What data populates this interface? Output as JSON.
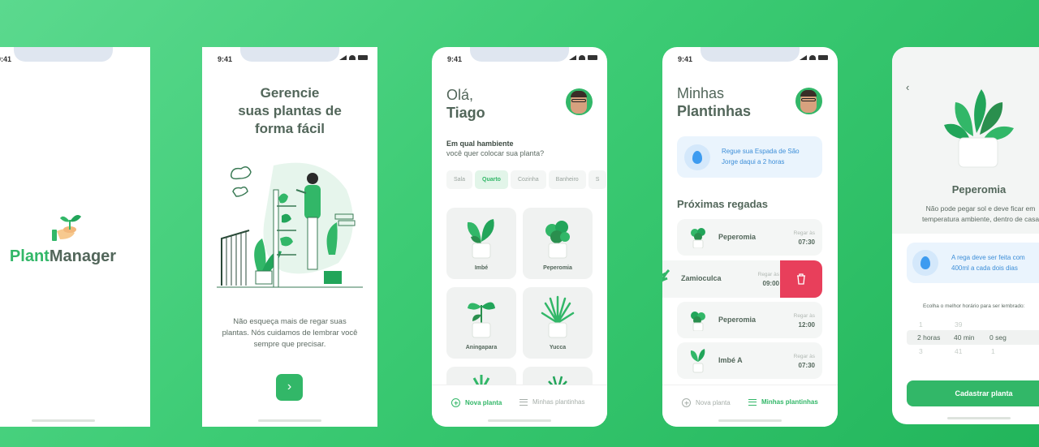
{
  "theme": {
    "accent": "#32b768",
    "heading": "#52665a",
    "danger": "#e83f5b",
    "info": "#3d9bf0"
  },
  "status_time": "9:41",
  "splash": {
    "logo_part1": "Plant",
    "logo_part2": "Manager"
  },
  "onboarding": {
    "title_lines": [
      "Gerencie",
      "suas plantas de",
      "forma fácil"
    ],
    "text_lines": [
      "Não esqueça mais de regar suas",
      "plantas. Nós cuidamos de lembrar você",
      "sempre que precisar."
    ],
    "next_icon": "chevron-right-icon",
    "next_glyph": "›"
  },
  "home": {
    "greeting": "Olá,",
    "user_name": "Tiago",
    "question_bold": "Em qual hambiente",
    "question_rest": "você quer colocar sua planta?",
    "environments": [
      {
        "label": "Sala",
        "active": false
      },
      {
        "label": "Quarto",
        "active": true
      },
      {
        "label": "Cozinha",
        "active": false
      },
      {
        "label": "Banheiro",
        "active": false
      },
      {
        "label": "S",
        "active": false
      }
    ],
    "plants": [
      "Imbé",
      "Peperomia",
      "Aningapara",
      "Yucca"
    ],
    "tabs": {
      "new_plant": "Nova planta",
      "my_plants": "Minhas plantinhas"
    }
  },
  "my_plants": {
    "title_light": "Minhas",
    "title_bold": "Plantinhas",
    "tip_lines": [
      "Regue sua Espada de São",
      "Jorge daqui a 2 horas"
    ],
    "next_title": "Próximas regadas",
    "water_label": "Regar às",
    "rows": [
      {
        "name": "Peperomia",
        "time": "07:30"
      },
      {
        "name": "Zamioculca",
        "time": "09:00"
      },
      {
        "name": "Peperomia",
        "time": "12:00"
      },
      {
        "name": "Imbé A",
        "time": "07:30"
      }
    ],
    "delete_icon": "trash-icon",
    "tabs": {
      "new_plant": "Nova planta",
      "my_plants": "Minhas plantinhas"
    }
  },
  "detail": {
    "back_glyph": "‹",
    "name": "Peperomia",
    "desc_lines": [
      "Não pode pegar sol e deve ficar em",
      "temperatura ambiente, dentro de casa"
    ],
    "tip_lines": [
      "A rega deve ser feita com",
      "400ml a cada dois dias"
    ],
    "choose_label": "Ecolha o melhor horário para ser lembrado:",
    "picker_rows": [
      {
        "h": "1",
        "m": "39",
        "s": ""
      },
      {
        "h": "2 horas",
        "m": "40 min",
        "s": "0 seg"
      },
      {
        "h": "3",
        "m": "41",
        "s": "1"
      }
    ],
    "save_button": "Cadastrar planta"
  }
}
